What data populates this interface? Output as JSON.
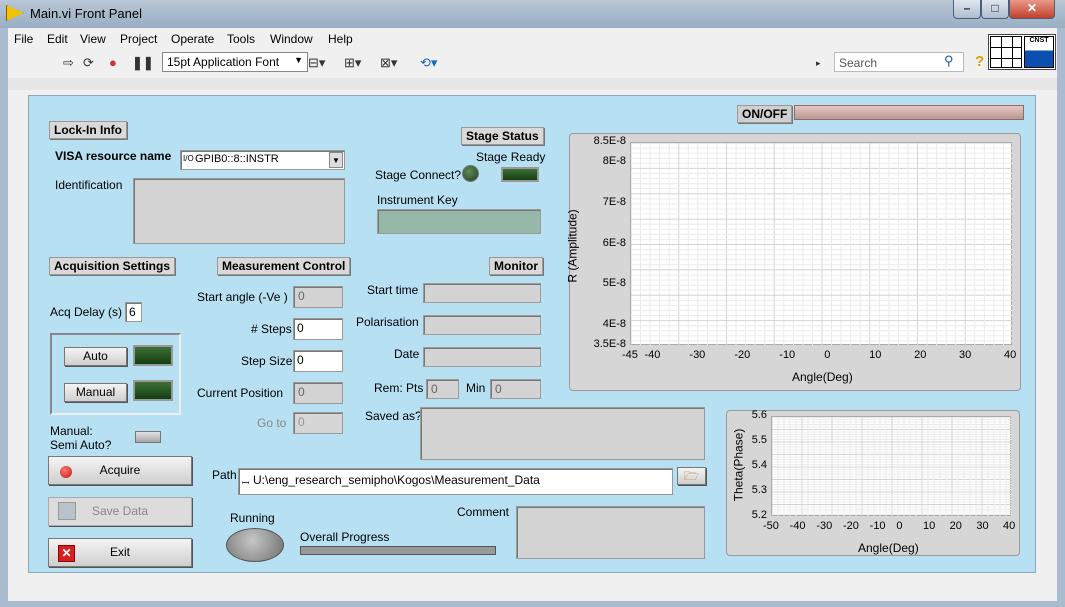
{
  "window": {
    "title": "Main.vi Front Panel",
    "min": "–",
    "max": "□",
    "close": "✕"
  },
  "menu": [
    "File",
    "Edit",
    "View",
    "Project",
    "Operate",
    "Tools",
    "Window",
    "Help"
  ],
  "toolbar": {
    "font": "15pt Application Font",
    "search_placeholder": "Search",
    "logo": "CNST"
  },
  "panel": {
    "onoff_label": "ON/OFF",
    "lockin": {
      "header": "Lock-In Info",
      "visa_label": "VISA resource name",
      "visa_value": "GPIB0::8::INSTR",
      "identification_label": "Identification"
    },
    "stage": {
      "header": "Stage Status",
      "connect_label": "Stage Connect?",
      "ready_label": "Stage Ready",
      "instrument_key_label": "Instrument Key"
    },
    "acq": {
      "header": "Acquisition Settings",
      "delay_label": "Acq Delay (s)",
      "delay_value": "6",
      "auto_label": "Auto",
      "manual_label": "Manual",
      "semi_label_1": "Manual:",
      "semi_label_2": "Semi Auto?"
    },
    "measure": {
      "header": "Measurement Control",
      "start_angle_label": "Start angle (-Ve )",
      "start_angle_value": "0",
      "steps_label": "# Steps",
      "steps_value": "0",
      "step_size_label": "Step Size",
      "step_size_value": "0",
      "current_pos_label": "Current Position",
      "current_pos_value": "0",
      "goto_label": "Go to",
      "goto_value": "0"
    },
    "monitor": {
      "header": "Monitor",
      "start_time_label": "Start time",
      "polarisation_label": "Polarisation",
      "date_label": "Date",
      "rem_pts_label": "Rem: Pts",
      "rem_pts_value": "0",
      "min_label": "Min",
      "min_value": "0",
      "saved_as_label": "Saved as?"
    },
    "buttons": {
      "acquire": "Acquire",
      "save": "Save Data",
      "exit": "Exit"
    },
    "path_label": "Path",
    "path_value": "U:\\eng_research_semipho\\Kogos\\Measurement_Data",
    "running_label": "Running",
    "progress_label": "Overall Progress",
    "progress_value": 0,
    "comment_label": "Comment"
  },
  "chart_data": [
    {
      "type": "line",
      "title": "",
      "xlabel": "Angle(Deg)",
      "ylabel": "R (Amplitude)",
      "x_ticks": [
        "-45",
        "-40",
        "-30",
        "-20",
        "-10",
        "0",
        "10",
        "20",
        "30",
        "40"
      ],
      "y_ticks": [
        "8.5E-8",
        "8E-8",
        "7E-8",
        "6E-8",
        "5E-8",
        "4E-8",
        "3.5E-8"
      ],
      "xlim": [
        -45,
        40
      ],
      "ylim": [
        3.5e-08,
        8.5e-08
      ],
      "grid": true,
      "series": []
    },
    {
      "type": "line",
      "title": "",
      "xlabel": "Angle(Deg)",
      "ylabel": "Theta(Phase)",
      "x_ticks": [
        "-50",
        "-40",
        "-30",
        "-20",
        "-10",
        "0",
        "10",
        "20",
        "30",
        "40"
      ],
      "y_ticks": [
        "5.6",
        "5.5",
        "5.4",
        "5.3",
        "5.2"
      ],
      "xlim": [
        -50,
        40
      ],
      "ylim": [
        5.2,
        5.6
      ],
      "grid": true,
      "series": []
    }
  ]
}
